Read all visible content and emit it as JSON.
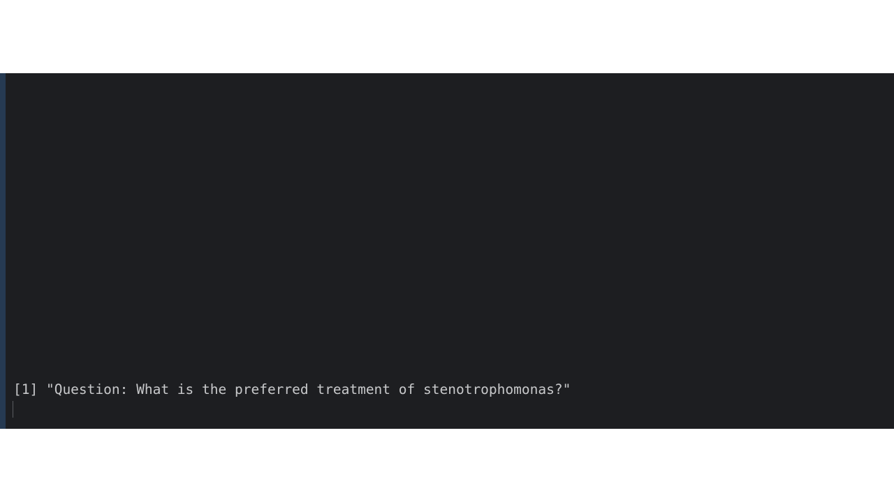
{
  "console": {
    "output_line": "[1] \"Question: What is the preferred treatment of stenotrophomonas?\"",
    "input_value": ""
  },
  "colors": {
    "console_background": "#1d1e21",
    "console_text": "#c8c9cb",
    "edge_accent": "#263a52",
    "page_background": "#ffffff"
  }
}
